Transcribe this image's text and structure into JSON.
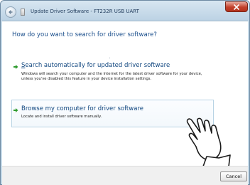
{
  "window": {
    "title": "Update Driver Software - FT232R USB UART"
  },
  "heading": "How do you want to search for driver software?",
  "options": [
    {
      "title_accel": "S",
      "title_rest": "earch automatically for updated driver software",
      "description": "Windows will search your computer and the Internet for the latest driver software for your device, unless you've disabled this feature in your device installation settings."
    },
    {
      "title_accel": "",
      "title_rest": "Browse my computer for driver software",
      "description": "Locate and install driver software manually."
    }
  ],
  "buttons": {
    "cancel": "Cancel"
  },
  "colors": {
    "heading": "#1b4f8c",
    "link": "#10467f",
    "arrow": "#2e9b2e",
    "close": "#c2402b"
  },
  "icons": {
    "back": "back-arrow-icon",
    "close": "close-x-icon",
    "app": "device-icon",
    "option_arrow": "green-arrow-icon",
    "pointer": "hand-pointer-icon"
  }
}
